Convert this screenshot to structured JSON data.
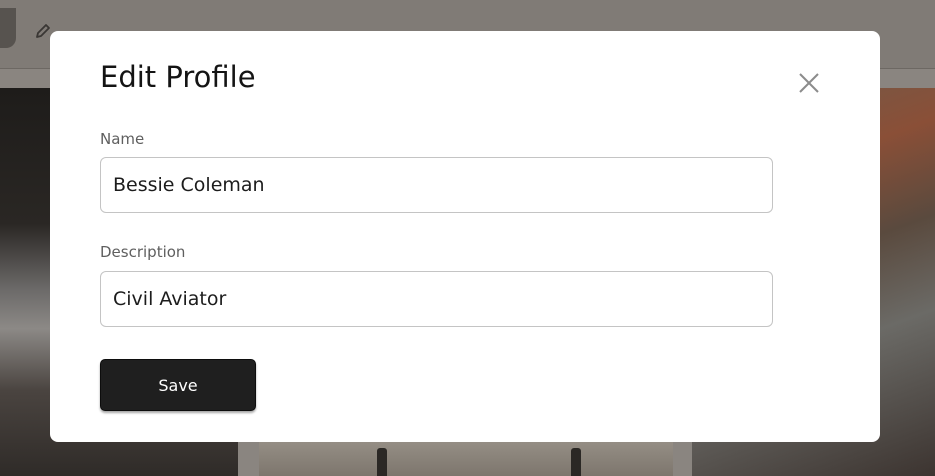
{
  "dialog": {
    "title": "Edit Profile",
    "name_label": "Name",
    "name_value": "Bessie Coleman",
    "description_label": "Description",
    "description_value": "Civil Aviator",
    "save_label": "Save"
  },
  "icons": {
    "close": "close-icon",
    "edit": "pencil-icon"
  },
  "colors": {
    "overlay": "#8a8580",
    "modal_bg": "#ffffff",
    "save_button_bg": "#1f1f1f",
    "input_border": "#c4c4c4",
    "label_text": "#5f5f5f"
  }
}
